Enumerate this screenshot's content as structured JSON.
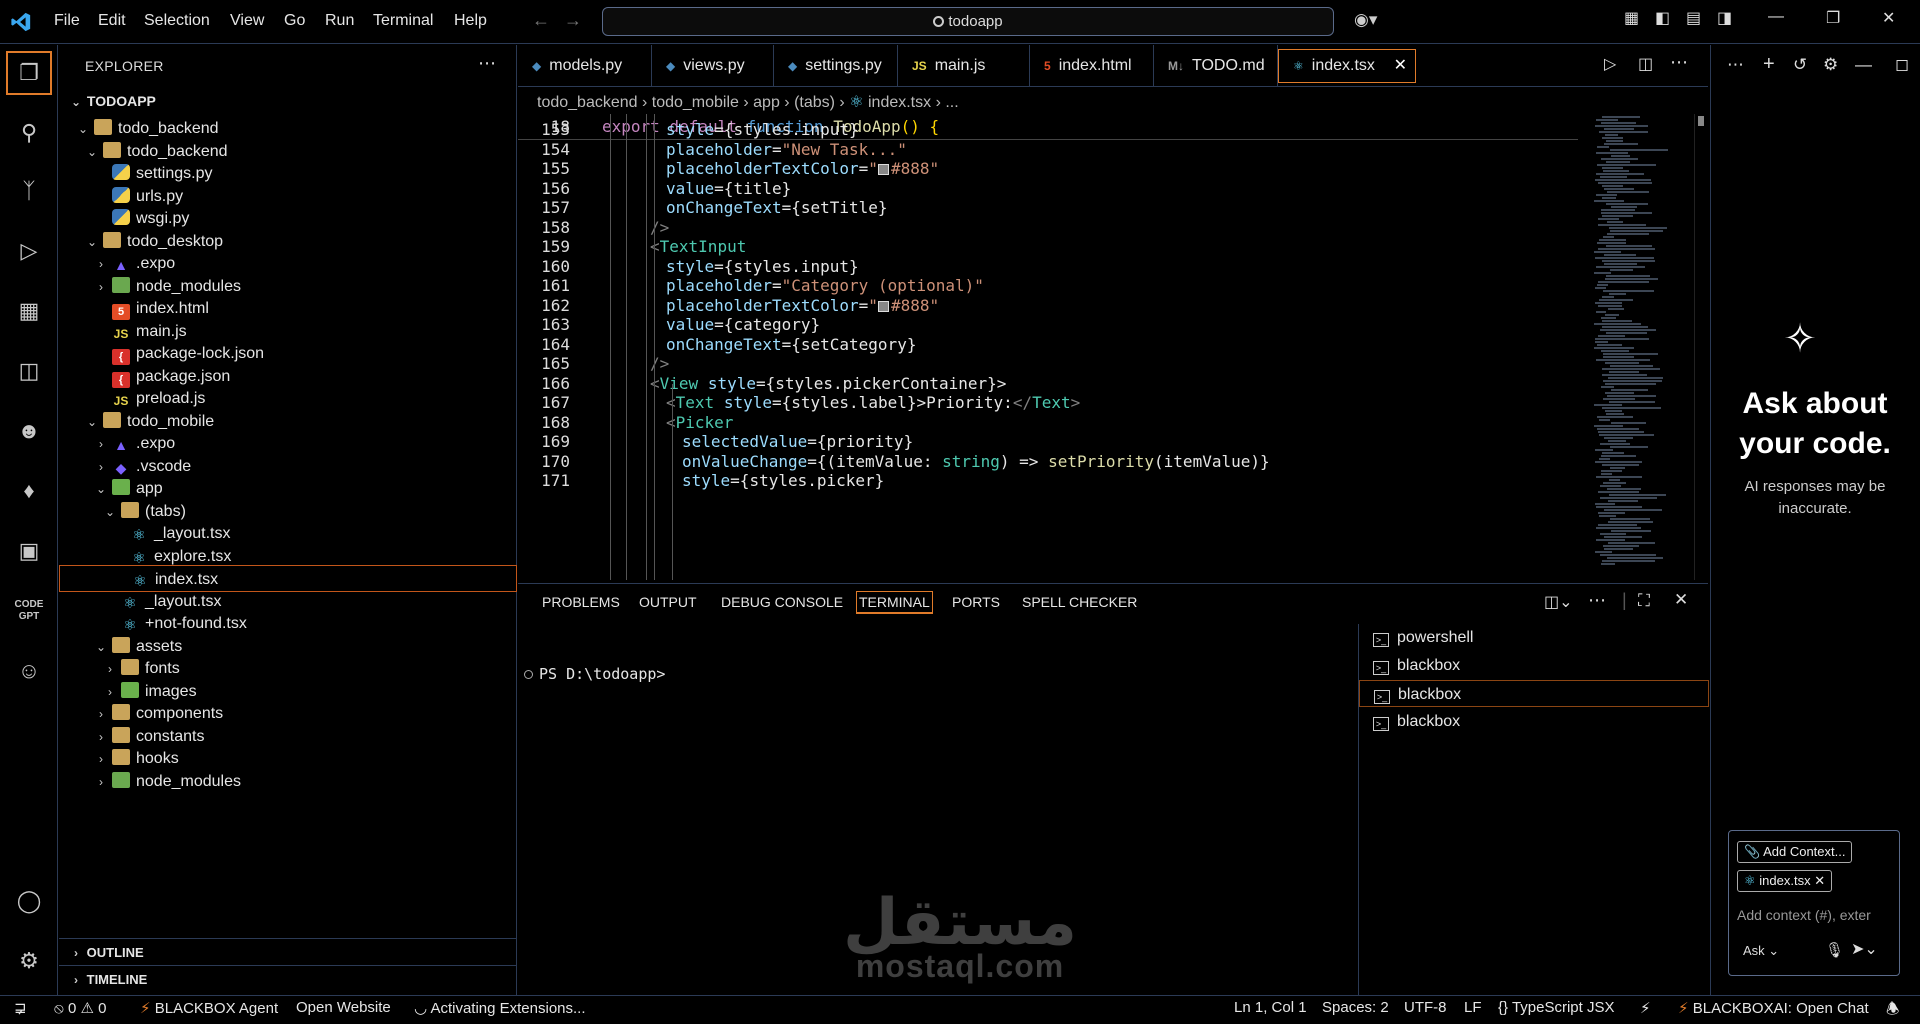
{
  "menu": [
    "File",
    "Edit",
    "Selection",
    "View",
    "Go",
    "Run",
    "Terminal",
    "Help"
  ],
  "search": {
    "text": "todoapp"
  },
  "sidebar": {
    "header": "EXPLORER",
    "root": "TODOAPP",
    "rows": [
      {
        "label": "todo_backend",
        "depth": 1,
        "type": "folder",
        "open": true
      },
      {
        "label": "todo_backend",
        "depth": 2,
        "type": "folder",
        "open": true
      },
      {
        "label": "settings.py",
        "depth": 3,
        "type": "py"
      },
      {
        "label": "urls.py",
        "depth": 3,
        "type": "py"
      },
      {
        "label": "wsgi.py",
        "depth": 3,
        "type": "py"
      },
      {
        "label": "todo_desktop",
        "depth": 2,
        "type": "folder",
        "open": true
      },
      {
        "label": ".expo",
        "depth": 3,
        "type": "expo",
        "open": false
      },
      {
        "label": "node_modules",
        "depth": 3,
        "type": "nodefld",
        "open": false
      },
      {
        "label": "index.html",
        "depth": 3,
        "type": "html5"
      },
      {
        "label": "main.js",
        "depth": 3,
        "type": "js"
      },
      {
        "label": "package-lock.json",
        "depth": 3,
        "type": "json"
      },
      {
        "label": "package.json",
        "depth": 3,
        "type": "json"
      },
      {
        "label": "preload.js",
        "depth": 3,
        "type": "js"
      },
      {
        "label": "todo_mobile",
        "depth": 2,
        "type": "folder",
        "open": true
      },
      {
        "label": ".expo",
        "depth": 3,
        "type": "expo",
        "open": false
      },
      {
        "label": ".vscode",
        "depth": 3,
        "type": "vscode",
        "open": false
      },
      {
        "label": "app",
        "depth": 3,
        "type": "special",
        "open": true
      },
      {
        "label": "(tabs)",
        "depth": 4,
        "type": "folder",
        "open": true
      },
      {
        "label": "_layout.tsx",
        "depth": 5,
        "type": "react"
      },
      {
        "label": "explore.tsx",
        "depth": 5,
        "type": "react"
      },
      {
        "label": "index.tsx",
        "depth": 5,
        "type": "react",
        "selected": true
      },
      {
        "label": "_layout.tsx",
        "depth": 4,
        "type": "react"
      },
      {
        "label": "+not-found.tsx",
        "depth": 4,
        "type": "react"
      },
      {
        "label": "assets",
        "depth": 3,
        "type": "folder",
        "open": true
      },
      {
        "label": "fonts",
        "depth": 4,
        "type": "folder",
        "open": false
      },
      {
        "label": "images",
        "depth": 4,
        "type": "special",
        "open": false
      },
      {
        "label": "components",
        "depth": 3,
        "type": "folder",
        "open": false
      },
      {
        "label": "constants",
        "depth": 3,
        "type": "folder",
        "open": false
      },
      {
        "label": "hooks",
        "depth": 3,
        "type": "folder",
        "open": false
      },
      {
        "label": "node_modules",
        "depth": 3,
        "type": "nodefld",
        "open": false
      }
    ],
    "outline": "OUTLINE",
    "timeline": "TIMELINE"
  },
  "tabs": [
    {
      "label": "models.py",
      "icon": "py"
    },
    {
      "label": "views.py",
      "icon": "py"
    },
    {
      "label": "settings.py",
      "icon": "py"
    },
    {
      "label": "main.js",
      "icon": "js"
    },
    {
      "label": "index.html",
      "icon": "html5"
    },
    {
      "label": "TODO.md",
      "icon": "md"
    },
    {
      "label": "index.tsx",
      "icon": "react",
      "active": true
    }
  ],
  "breadcrumb": [
    "todo_backend",
    "todo_mobile",
    "app",
    "(tabs)",
    "index.tsx",
    "..."
  ],
  "code": {
    "sticky_line": "18",
    "sticky_text": "export default function TodoApp() {",
    "lines": [
      {
        "n": "153",
        "t": "style={styles.input}"
      },
      {
        "n": "154",
        "t": "placeholder=\"New Task...\""
      },
      {
        "n": "155",
        "t": "placeholderTextColor=\"#888\""
      },
      {
        "n": "156",
        "t": "value={title}"
      },
      {
        "n": "157",
        "t": "onChangeText={setTitle}"
      },
      {
        "n": "158",
        "t": "/>"
      },
      {
        "n": "159",
        "t": "<TextInput"
      },
      {
        "n": "160",
        "t": "style={styles.input}"
      },
      {
        "n": "161",
        "t": "placeholder=\"Category (optional)\""
      },
      {
        "n": "162",
        "t": "placeholderTextColor=\"#888\""
      },
      {
        "n": "163",
        "t": "value={category}"
      },
      {
        "n": "164",
        "t": "onChangeText={setCategory}"
      },
      {
        "n": "165",
        "t": "/>"
      },
      {
        "n": "166",
        "t": "<View style={styles.pickerContainer}>"
      },
      {
        "n": "167",
        "t": "<Text style={styles.label}>Priority:</Text>"
      },
      {
        "n": "168",
        "t": "<Picker"
      },
      {
        "n": "169",
        "t": "selectedValue={priority}"
      },
      {
        "n": "170",
        "t": "onValueChange={(itemValue: string) => setPriority(itemValue)}"
      },
      {
        "n": "171",
        "t": "style={styles.picker}"
      }
    ]
  },
  "panel": {
    "tabs": [
      "PROBLEMS",
      "OUTPUT",
      "DEBUG CONSOLE",
      "TERMINAL",
      "PORTS",
      "SPELL CHECKER"
    ],
    "active_tab": "TERMINAL",
    "prompt": "PS D:\\todoapp>",
    "terminals": [
      "powershell",
      "blackbox",
      "blackbox",
      "blackbox"
    ]
  },
  "chat": {
    "title": "Ask about your code.",
    "subtitle": "AI responses may be inaccurate.",
    "add_context": "Add Context...",
    "context_file": "index.tsx",
    "placeholder": "Add context (#), exter",
    "mode": "Ask"
  },
  "status": {
    "errors": "0",
    "warnings": "0",
    "agent": "BLACKBOX Agent",
    "open_website": "Open Website",
    "activating": "Activating Extensions...",
    "position": "Ln 1, Col 1",
    "spaces": "Spaces: 2",
    "encoding": "UTF-8",
    "eol": "LF",
    "language": "TypeScript JSX",
    "chat": "BLACKBOXAI: Open Chat"
  },
  "watermark": {
    "arabic": "مستقل",
    "latin": "mostaql.com"
  },
  "colors": {
    "accent": "#e07b2a",
    "border": "#2b3a55",
    "background": "#000000"
  }
}
